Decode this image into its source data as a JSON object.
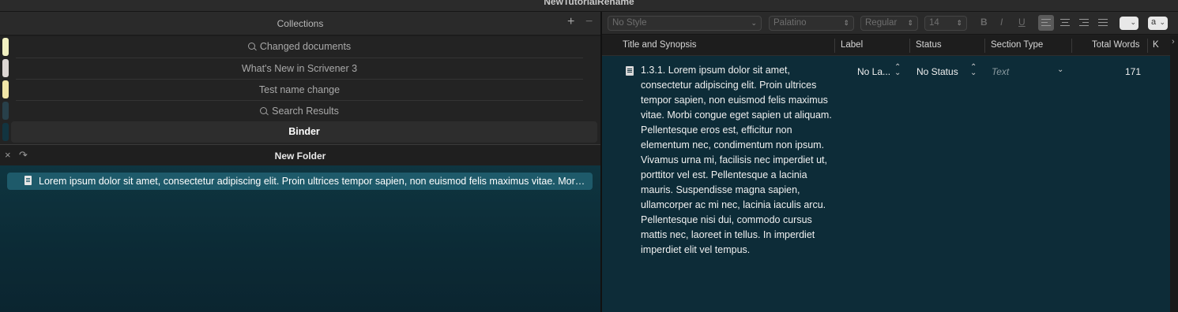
{
  "window": {
    "title": "NewTutorialRename"
  },
  "collections": {
    "title": "Collections",
    "add_label": "+",
    "remove_label": "−",
    "items": [
      {
        "label": "Changed documents",
        "search": true,
        "color": "#f2f1c2"
      },
      {
        "label": "What's New in Scrivener 3",
        "search": false,
        "color": "#dcd6d3"
      },
      {
        "label": "Test name change",
        "search": false,
        "color": "#f2e7a8"
      },
      {
        "label": "Search Results",
        "search": true,
        "color": "#28404a"
      },
      {
        "label": "Binder",
        "search": false,
        "color": "#123440",
        "selected": true
      }
    ]
  },
  "folder": {
    "title": "New Folder",
    "close_label": "×",
    "redo_label": "↷",
    "items": [
      {
        "label": "Lorem ipsum dolor sit amet, consectetur adipiscing elit. Proin ultrices tempor sapien, non euismod felis maximus vitae. Morbi congue eget sapien ut aliquam. Pellentesque eros est, efficitur non elementum nec, condimentum non ipsum."
      }
    ]
  },
  "format_bar": {
    "style": "No Style",
    "font": "Palatino",
    "weight": "Regular",
    "size": "14",
    "bold": "B",
    "italic": "I",
    "underline": "U",
    "text_color_label": "a"
  },
  "outline": {
    "columns": {
      "title": "Title and Synopsis",
      "label": "Label",
      "status": "Status",
      "section_type": "Section Type",
      "total_words": "Total Words",
      "extra": "K"
    },
    "rows": [
      {
        "synopsis": "1.3.1. Lorem ipsum dolor sit amet, consectetur adipiscing elit. Proin ultrices tempor sapien, non euismod felis maximus vitae. Morbi congue eget sapien ut aliquam. Pellentesque eros est, efficitur non elementum nec, condimentum non ipsum. Vivamus urna mi, facilisis nec imperdiet ut, porttitor vel est. Pellentesque a lacinia mauris. Suspendisse magna sapien, ullamcorper ac mi nec, lacinia iaculis arcu. Pellentesque nisi dui, commodo cursus mattis nec, laoreet in tellus. In imperdiet imperdiet elit vel tempus.",
        "label": "No La...",
        "status": "No Status",
        "section_type": "Text",
        "total_words": "171"
      }
    ]
  }
}
